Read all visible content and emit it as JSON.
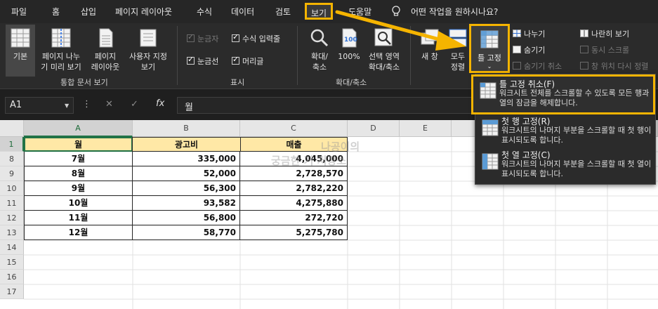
{
  "menu": {
    "file": "파일",
    "home": "홈",
    "insert": "삽입",
    "page_layout": "페이지 레이아웃",
    "formulas": "수식",
    "data": "데이터",
    "review": "검토",
    "view": "보기",
    "help": "도움말",
    "tell_me": "어떤 작업을 원하시나요?"
  },
  "ribbon": {
    "workbook_views": {
      "normal": "기본",
      "page_break_line1": "페이지 나누",
      "page_break_line2": "기 미리 보기",
      "page_layout_line1": "페이지",
      "page_layout_line2": "레이아웃",
      "custom_line1": "사용자 지정",
      "custom_line2": "보기",
      "group_label": "통합 문서 보기"
    },
    "show": {
      "ruler": "눈금자",
      "formula_bar": "수식 입력줄",
      "gridlines": "눈금선",
      "headings": "머리글",
      "group_label": "표시"
    },
    "zoom": {
      "zoom_line1": "확대/",
      "zoom_line2": "축소",
      "hundred": "100%",
      "selection_line1": "선택 영역",
      "selection_line2": "확대/축소",
      "group_label": "확대/축소"
    },
    "window": {
      "new_window": "새 창",
      "arrange_line1": "모두",
      "arrange_line2": "정렬",
      "freeze_panes": "틀 고정",
      "split": "나누기",
      "hide": "숨기기",
      "unhide": "숨기기 취소",
      "side_by_side": "나란히 보기",
      "sync_scroll": "동시 스크롤",
      "reset_position": "창 위치 다시 정렬"
    }
  },
  "formula_bar": {
    "name_box": "A1",
    "fx": "fx",
    "content": "월"
  },
  "sheet": {
    "columns": [
      "A",
      "B",
      "C",
      "D",
      "E",
      "F"
    ],
    "row_numbers": [
      "1",
      "8",
      "9",
      "10",
      "11",
      "12",
      "13",
      "14",
      "15",
      "16",
      "17"
    ],
    "header_row": [
      "월",
      "광고비",
      "매출"
    ],
    "rows": [
      [
        "7월",
        "335,000",
        "4,045,000"
      ],
      [
        "8월",
        "52,000",
        "2,728,570"
      ],
      [
        "9월",
        "56,300",
        "2,782,220"
      ],
      [
        "10월",
        "93,582",
        "4,275,880"
      ],
      [
        "11월",
        "56,800",
        "272,720"
      ],
      [
        "12월",
        "58,770",
        "5,275,780"
      ]
    ],
    "watermark_line1": "나공이의",
    "watermark_line2": "궁금한 거 저장소"
  },
  "freeze_menu": {
    "items": [
      {
        "title": "틀 고정 취소(F)",
        "desc": "워크시트 전체를 스크롤할 수 있도록 모든 행과 열의 잠금을 해제합니다."
      },
      {
        "title": "첫 행 고정(R)",
        "desc": "워크시트의 나머지 부분을 스크롤할 때 첫 행이 표시되도록 합니다."
      },
      {
        "title": "첫 열 고정(C)",
        "desc": "워크시트의 나머지 부분을 스크롤할 때 첫 열이 표시되도록 합니다."
      }
    ]
  },
  "colors": {
    "accent_highlight": "#f5b400",
    "header_fill": "#ffe8a6",
    "excel_green": "#217346"
  }
}
